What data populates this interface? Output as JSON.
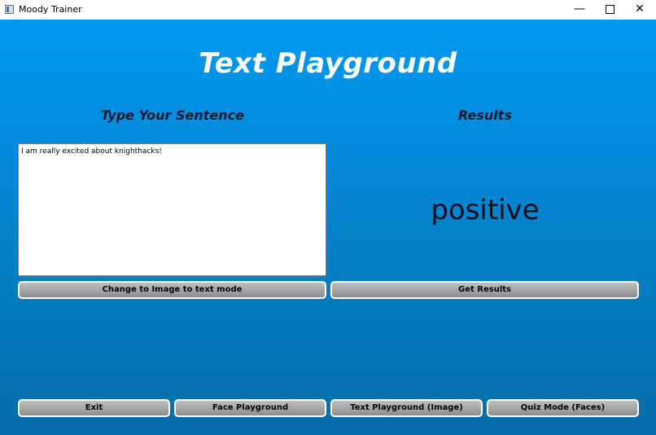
{
  "window": {
    "title": "Moody Trainer",
    "minimize_glyph": "—",
    "close_glyph": "✕"
  },
  "page": {
    "title": "Text Playground"
  },
  "input_section": {
    "heading": "Type Your Sentence",
    "text_value": "I am really excited about knighthacks!",
    "mode_button_label": "Change to Image to text mode"
  },
  "results_section": {
    "heading": "Results",
    "result_value": "positive",
    "get_results_label": "Get Results"
  },
  "nav": {
    "exit_label": "Exit",
    "face_playground_label": "Face Playground",
    "text_playground_image_label": "Text Playground (Image)",
    "quiz_mode_label": "Quiz Mode (Faces)"
  },
  "colors": {
    "background_top": "#0299f3",
    "background_bottom": "#046da9",
    "title_text": "#ffffff",
    "button_face": "#a6a6a6",
    "button_border": "#ffffff"
  }
}
